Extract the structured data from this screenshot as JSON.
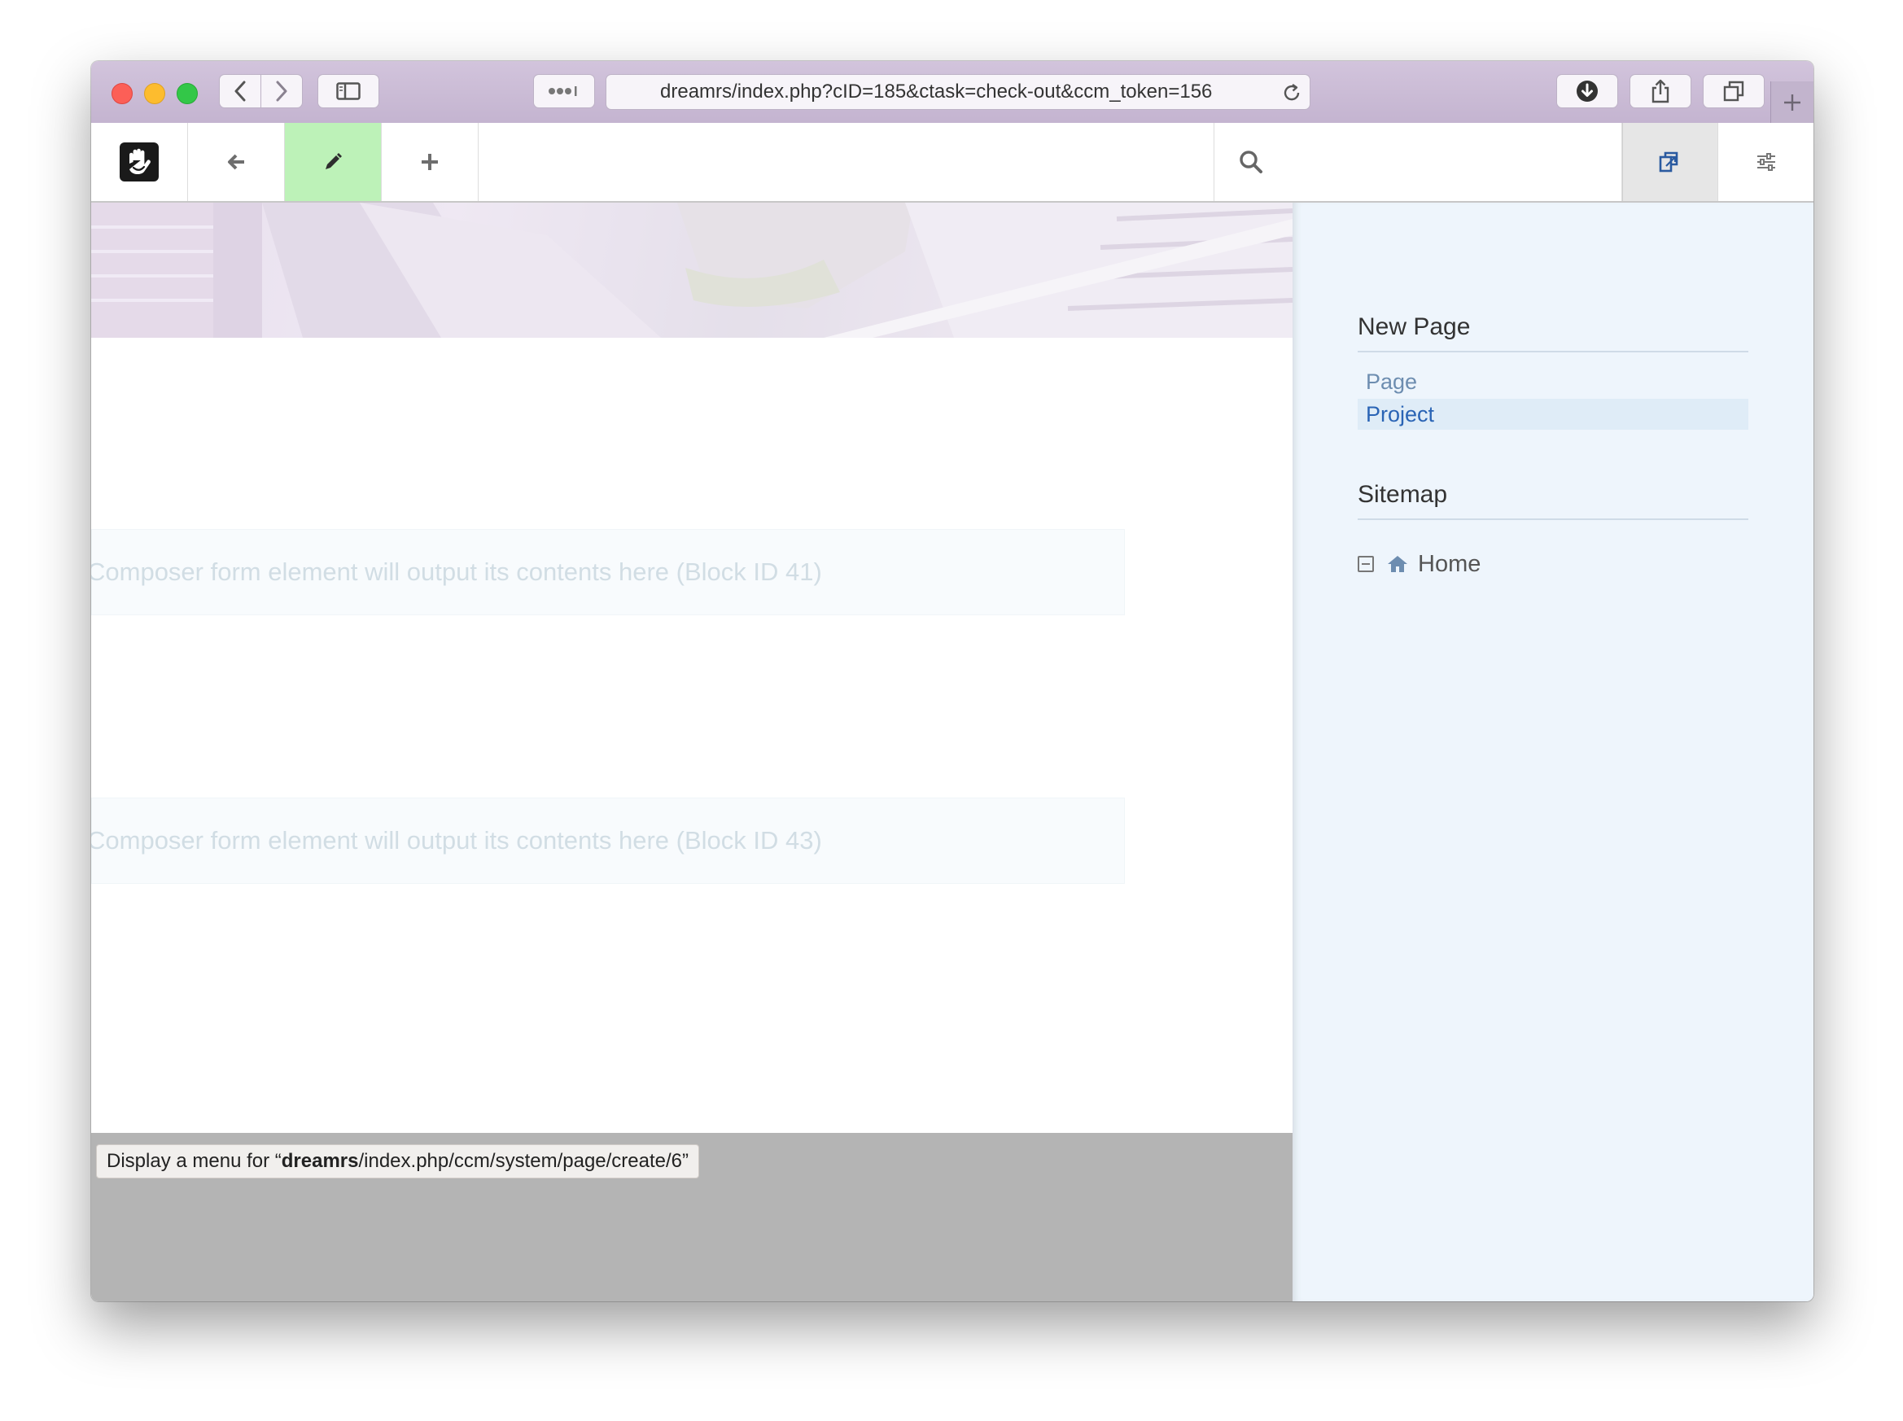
{
  "browser": {
    "url": "dreamrs/index.php?cID=185&ctask=check-out&ccm_token=156",
    "icons": {
      "back": "chevron-left-icon",
      "forward": "chevron-right-icon",
      "sidebar": "sidebar-icon",
      "extensions": "more-dots-icon",
      "reload": "reload-icon",
      "downloads": "download-icon",
      "share": "share-icon",
      "tabs": "tabs-overview-icon",
      "new_tab": "plus-icon"
    }
  },
  "cms_toolbar": {
    "logo": "concrete-hand-logo",
    "active_color": "#bdf2b8",
    "search_placeholder": ""
  },
  "content": {
    "blocks": [
      {
        "text": "Composer form element will output its contents here (Block ID 41)"
      },
      {
        "text": "Composer form element will output its contents here (Block ID 43)"
      }
    ],
    "status_bar": {
      "prefix": "Display a menu for “",
      "host": "dreamrs",
      "path": "/index.php/ccm/system/page/create/6”"
    }
  },
  "panel": {
    "new_page_heading": "New Page",
    "page_types": [
      {
        "label": "Page",
        "selected": false
      },
      {
        "label": "Project",
        "selected": true
      }
    ],
    "sitemap_heading": "Sitemap",
    "tree": [
      {
        "label": "Home",
        "expanded": true,
        "icon": "home-icon"
      }
    ],
    "colors": {
      "link": "#6d8db0",
      "selected_link": "#2a64b5",
      "selected_bg": "#dfecf7"
    }
  }
}
